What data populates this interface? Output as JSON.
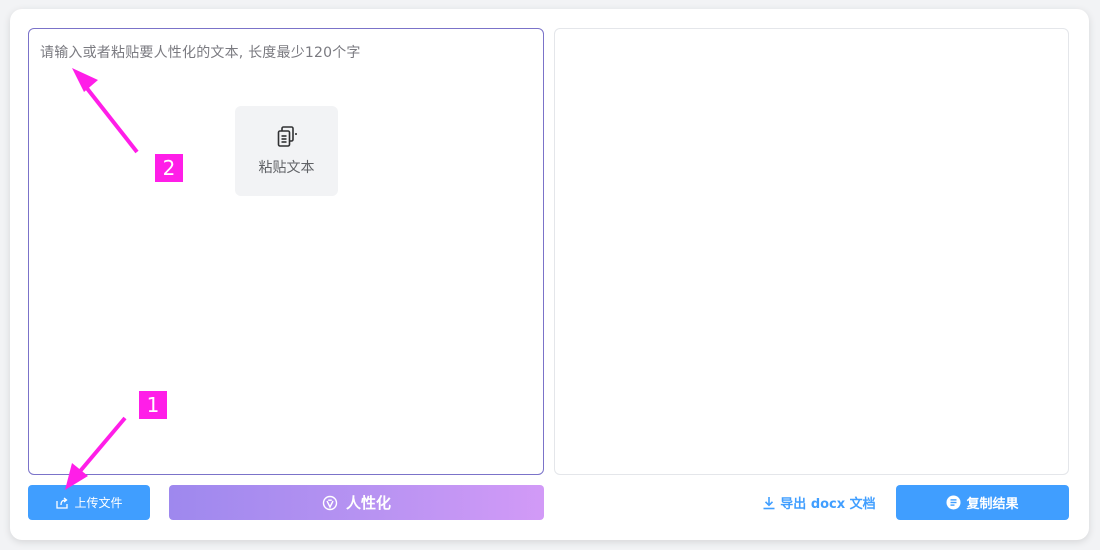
{
  "input": {
    "placeholder": "请输入或者粘贴要人性化的文本, 长度最少120个字",
    "paste_label": "粘贴文本"
  },
  "actions": {
    "upload_label": "上传文件",
    "humanize_label": "人性化",
    "export_label": "导出 docx 文档",
    "copy_label": "复制结果"
  },
  "annotations": {
    "marker_1": "1",
    "marker_2": "2"
  },
  "colors": {
    "primary": "#409eff",
    "annotation": "#ff1ee8",
    "input_border": "#7b73c9"
  },
  "icons": {
    "paste": "paste-icon",
    "upload": "upload-icon",
    "humanize": "humanize-icon",
    "download": "download-icon",
    "copy": "copy-icon"
  }
}
